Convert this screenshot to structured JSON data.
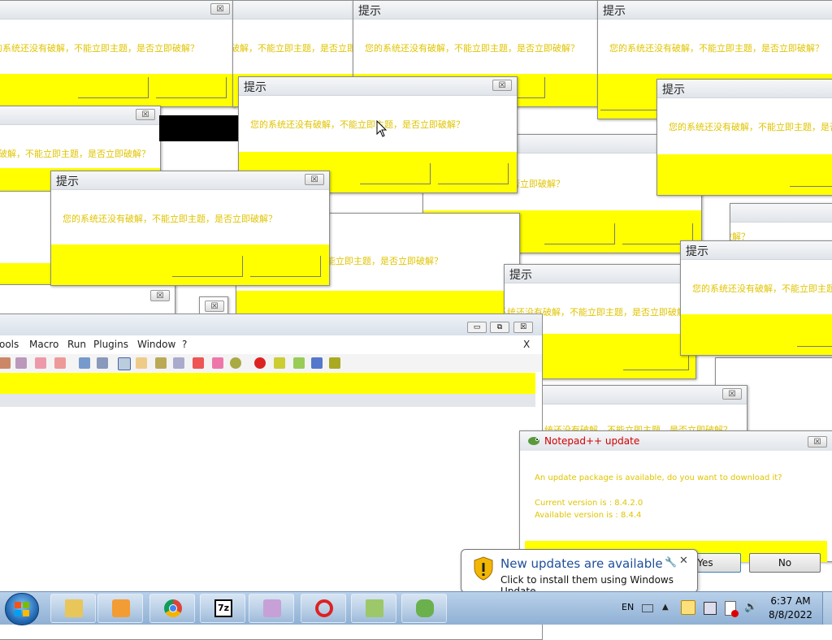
{
  "dialog": {
    "title": "提示",
    "message": "您的系统还没有破解，不能立即主题，是否立即破解？",
    "close_symbol": "☒"
  },
  "notepad": {
    "menu": [
      "ools",
      "Macro",
      "Run",
      "Plugins",
      "Window",
      "?"
    ],
    "close_symbol": "X"
  },
  "update_dialog": {
    "title": "Notepad++ update",
    "message": "An update package is available, do you want to download it?",
    "current_version": "Current version is :  8.4.2.0",
    "available_version": "Available version is :  8.4.4",
    "yes_label": "Yes",
    "no_label": "No"
  },
  "balloon": {
    "title": "New updates are available",
    "subtitle": "Click to install them using Windows Update."
  },
  "taskbar": {
    "language": "EN",
    "time": "6:37 AM",
    "date": "8/8/2022",
    "apps": [
      "explorer",
      "media-player",
      "chrome",
      "7zip",
      "game",
      "settings",
      "notepadpp-portable",
      "notepadpp-updater"
    ]
  },
  "colors": {
    "accent_yellow": "#ffff00",
    "text_yellow": "#e0c400",
    "update_title_red": "#d00000"
  }
}
